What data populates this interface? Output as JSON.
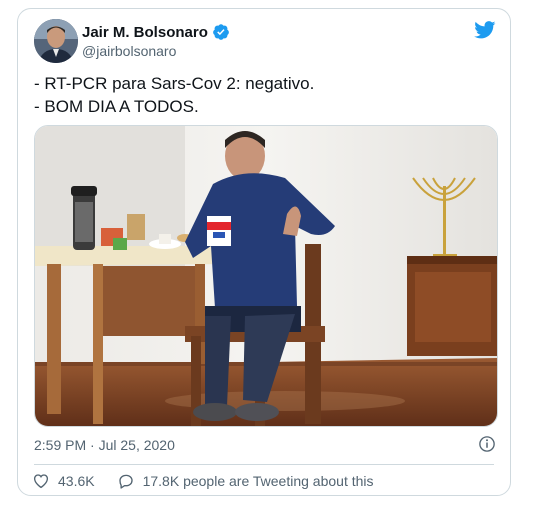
{
  "tweet": {
    "display_name": "Jair M. Bolsonaro",
    "handle": "@jairbolsonaro",
    "verified": true,
    "text_lines": [
      "- RT-PCR para Sars-Cov 2: negativo.",
      "- BOM DIA A TODOS."
    ],
    "timestamp": "2:59 PM · Jul 25, 2020",
    "likes": "43.6K",
    "retweet_text": "17.8K people are Tweeting about this"
  },
  "colors": {
    "brand": "#1d9bf0",
    "text": "#0f1419",
    "secondary": "#536471",
    "border": "#cfd9de"
  },
  "icons": {
    "brand": "twitter-bird-icon",
    "verified": "verified-badge-icon",
    "info": "info-icon",
    "like": "heart-icon",
    "reply": "speech-bubble-icon"
  }
}
